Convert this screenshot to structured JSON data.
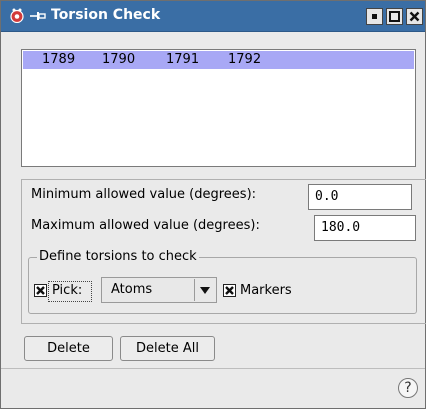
{
  "window": {
    "title": "Torsion Check",
    "title_bar_color": "#3a6ea5",
    "icons": [
      "app-icon",
      "pin-icon",
      "minimize-icon",
      "maximize-icon",
      "close-icon"
    ]
  },
  "torsion_list": {
    "rows": [
      {
        "atoms": [
          "1789",
          "1790",
          "1791",
          "1792"
        ],
        "selected": true
      }
    ],
    "selection_color": "#a8a8f5"
  },
  "limits": {
    "min_label": "Minimum allowed value (degrees):",
    "min_value": "0.0",
    "max_label": "Maximum allowed value (degrees):",
    "max_value": "180.0"
  },
  "define": {
    "group_title": "Define torsions to check",
    "pick_label": "Pick:",
    "pick_checked": true,
    "pick_mode": "Atoms",
    "markers_label": "Markers",
    "markers_checked": true
  },
  "buttons": {
    "delete": "Delete",
    "delete_all": "Delete All",
    "help": "?"
  }
}
